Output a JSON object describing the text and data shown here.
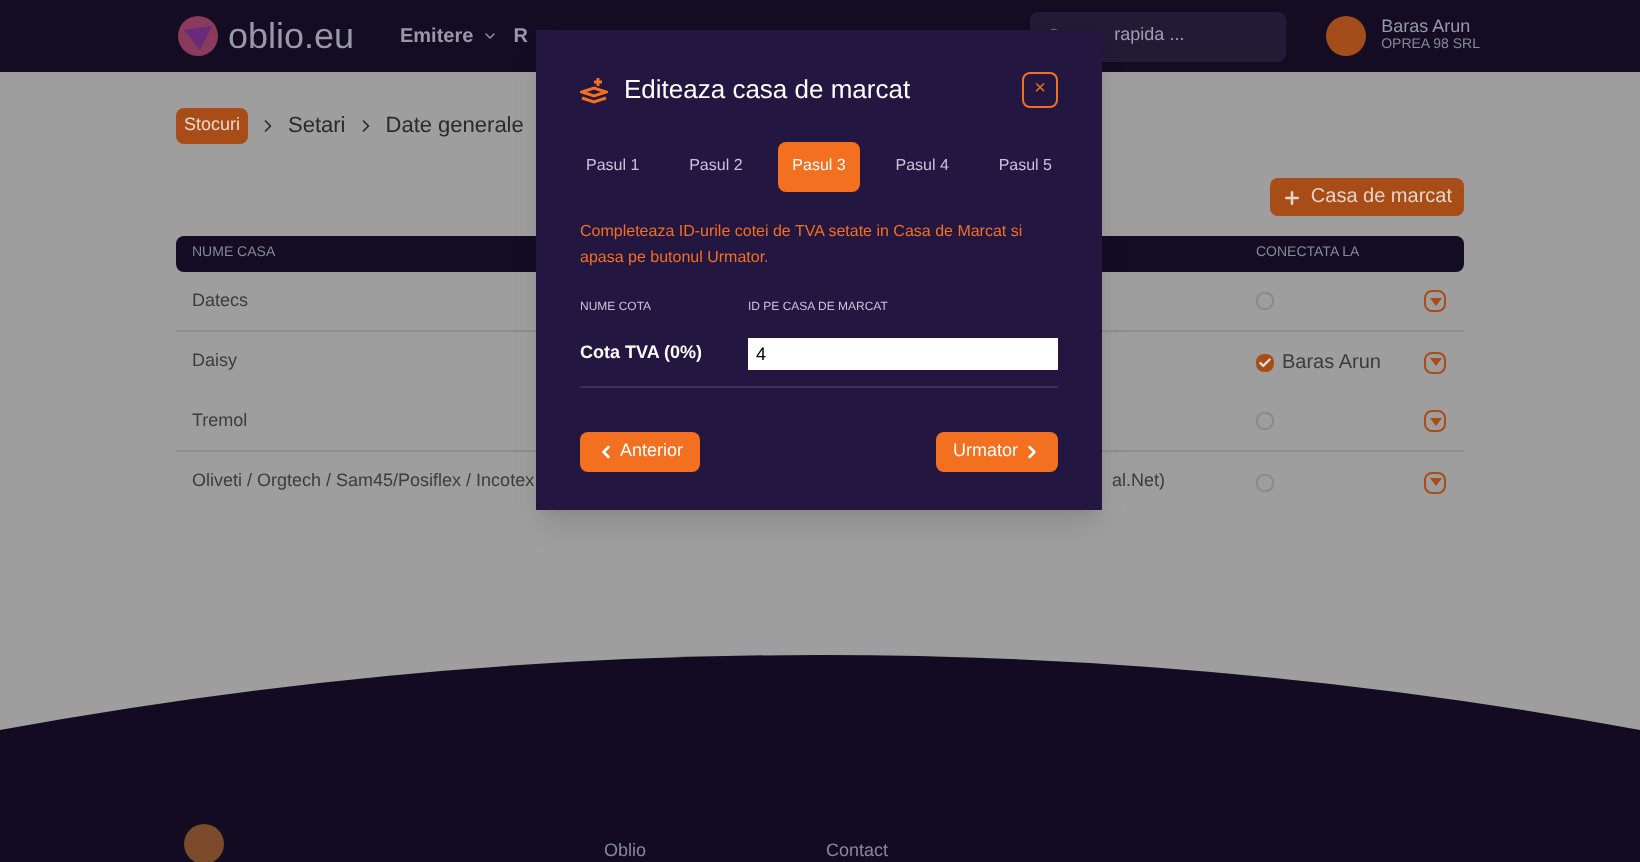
{
  "header": {
    "logo": "oblio.eu",
    "nav": [
      {
        "label": "Emitere",
        "dropdown": true
      },
      {
        "label": "R",
        "dropdown": false
      }
    ],
    "search": {
      "placeholder": "rapida ..."
    },
    "user": {
      "name": "Baras Arun",
      "company": "OPREA 98 SRL"
    }
  },
  "breadcrumb": [
    {
      "label": "Stocuri",
      "kind": "badge"
    },
    {
      "label": "Setari",
      "kind": "text"
    },
    {
      "label": "Date generale",
      "kind": "text"
    }
  ],
  "add_button": "Casa de marcat",
  "table": {
    "columns": [
      "NUME CASA",
      "CONECTATA LA"
    ],
    "rows": [
      {
        "name": "Datecs",
        "column_2": "",
        "checked": false,
        "connected_to": ""
      },
      {
        "name": "Daisy",
        "column_2": "",
        "checked": true,
        "connected_to": "Baras Arun"
      },
      {
        "name": "Tremol",
        "column_2": "",
        "checked": false,
        "connected_to": ""
      },
      {
        "name": "Oliveti / Orgtech / Sam45/Posiflex / Incotex",
        "column_2": "al.Net)",
        "checked": false,
        "connected_to": ""
      }
    ]
  },
  "footer": {
    "links": [
      "Oblio",
      "Contact"
    ]
  },
  "modal": {
    "title": "Editeaza casa de marcat",
    "close": "×",
    "steps": [
      {
        "label": "Pasul 1",
        "selected": false
      },
      {
        "label": "Pasul 2",
        "selected": false
      },
      {
        "label": "Pasul 3",
        "selected": true
      },
      {
        "label": "Pasul 4",
        "selected": false
      },
      {
        "label": "Pasul 5",
        "selected": false
      }
    ],
    "instruction": "Completeaza ID-urile cotei de TVA setate in Casa de Marcat si apasa pe butonul Urmator.",
    "columns": [
      "NUME COTA",
      "ID PE CASA DE MARCAT"
    ],
    "rows": [
      {
        "name": "Cota TVA (0%)",
        "value": "4"
      }
    ],
    "back": "Anterior",
    "next": "Urmator"
  }
}
